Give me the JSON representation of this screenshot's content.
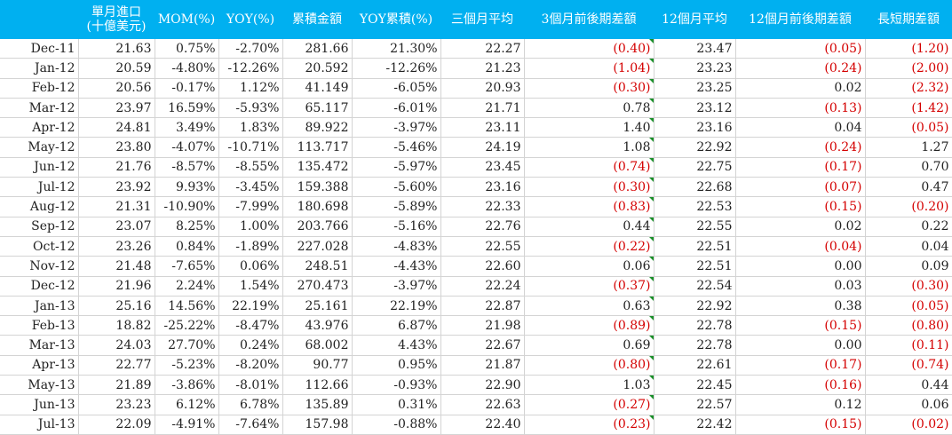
{
  "headers": [
    "",
    "單月進口 (十億美元)",
    "MOM(%)",
    "YOY(%)",
    "累積金額",
    "YOY累積(%)",
    "三個月平均",
    "3個月前後期差額",
    "12個月平均",
    "12個月前後期差額",
    "長短期差額"
  ],
  "header_line1": "單月進口",
  "header_line2": "(十億美元)",
  "rows": [
    [
      "Dec-11",
      "21.63",
      "0.75%",
      "-2.70%",
      "281.66",
      "21.30%",
      "22.27",
      "(0.40)",
      "23.47",
      "(0.05)",
      "(1.20)"
    ],
    [
      "Jan-12",
      "20.59",
      "-4.80%",
      "-12.26%",
      "20.592",
      "-12.26%",
      "21.23",
      "(1.04)",
      "23.23",
      "(0.24)",
      "(2.00)"
    ],
    [
      "Feb-12",
      "20.56",
      "-0.17%",
      "1.12%",
      "41.149",
      "-6.05%",
      "20.93",
      "(0.30)",
      "23.25",
      "0.02",
      "(2.32)"
    ],
    [
      "Mar-12",
      "23.97",
      "16.59%",
      "-5.93%",
      "65.117",
      "-6.01%",
      "21.71",
      "0.78",
      "23.12",
      "(0.13)",
      "(1.42)"
    ],
    [
      "Apr-12",
      "24.81",
      "3.49%",
      "1.83%",
      "89.922",
      "-3.97%",
      "23.11",
      "1.40",
      "23.16",
      "0.04",
      "(0.05)"
    ],
    [
      "May-12",
      "23.80",
      "-4.07%",
      "-10.71%",
      "113.717",
      "-5.46%",
      "24.19",
      "1.08",
      "22.92",
      "(0.24)",
      "1.27"
    ],
    [
      "Jun-12",
      "21.76",
      "-8.57%",
      "-8.55%",
      "135.472",
      "-5.97%",
      "23.45",
      "(0.74)",
      "22.75",
      "(0.17)",
      "0.70"
    ],
    [
      "Jul-12",
      "23.92",
      "9.93%",
      "-3.45%",
      "159.388",
      "-5.60%",
      "23.16",
      "(0.30)",
      "22.68",
      "(0.07)",
      "0.47"
    ],
    [
      "Aug-12",
      "21.31",
      "-10.90%",
      "-7.99%",
      "180.698",
      "-5.89%",
      "22.33",
      "(0.83)",
      "22.53",
      "(0.15)",
      "(0.20)"
    ],
    [
      "Sep-12",
      "23.07",
      "8.25%",
      "1.00%",
      "203.766",
      "-5.16%",
      "22.76",
      "0.44",
      "22.55",
      "0.02",
      "0.22"
    ],
    [
      "Oct-12",
      "23.26",
      "0.84%",
      "-1.89%",
      "227.028",
      "-4.83%",
      "22.55",
      "(0.22)",
      "22.51",
      "(0.04)",
      "0.04"
    ],
    [
      "Nov-12",
      "21.48",
      "-7.65%",
      "0.06%",
      "248.51",
      "-4.43%",
      "22.60",
      "0.06",
      "22.51",
      "0.00",
      "0.09"
    ],
    [
      "Dec-12",
      "21.96",
      "2.24%",
      "1.54%",
      "270.473",
      "-3.97%",
      "22.24",
      "(0.37)",
      "22.54",
      "0.03",
      "(0.30)"
    ],
    [
      "Jan-13",
      "25.16",
      "14.56%",
      "22.19%",
      "25.161",
      "22.19%",
      "22.87",
      "0.63",
      "22.92",
      "0.38",
      "(0.05)"
    ],
    [
      "Feb-13",
      "18.82",
      "-25.22%",
      "-8.47%",
      "43.976",
      "6.87%",
      "21.98",
      "(0.89)",
      "22.78",
      "(0.15)",
      "(0.80)"
    ],
    [
      "Mar-13",
      "24.03",
      "27.70%",
      "0.24%",
      "68.002",
      "4.43%",
      "22.67",
      "0.69",
      "22.78",
      "0.00",
      "(0.11)"
    ],
    [
      "Apr-13",
      "22.77",
      "-5.23%",
      "-8.20%",
      "90.77",
      "0.95%",
      "21.87",
      "(0.80)",
      "22.61",
      "(0.17)",
      "(0.74)"
    ],
    [
      "May-13",
      "21.89",
      "-3.86%",
      "-8.01%",
      "112.66",
      "-0.93%",
      "22.90",
      "1.03",
      "22.45",
      "(0.16)",
      "0.44"
    ],
    [
      "Jun-13",
      "23.23",
      "6.12%",
      "6.78%",
      "135.89",
      "0.31%",
      "22.63",
      "(0.27)",
      "22.57",
      "0.12",
      "0.06"
    ],
    [
      "Jul-13",
      "22.09",
      "-4.91%",
      "-7.64%",
      "157.98",
      "-0.88%",
      "22.40",
      "(0.23)",
      "22.42",
      "(0.15)",
      "(0.02)"
    ]
  ],
  "colors": {
    "header_bg": "#00b0f0",
    "header_text": "#ffffff",
    "negative": "#d40000",
    "flag": "#1a8f2a"
  }
}
